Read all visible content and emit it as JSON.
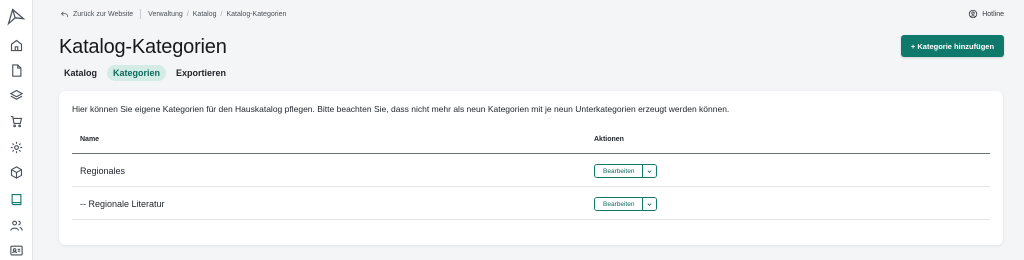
{
  "topbar": {
    "back_label": "Zurück zur Website",
    "breadcrumbs": [
      "Verwaltung",
      "Katalog",
      "Katalog-Kategorien"
    ],
    "hotline_label": "Hotline"
  },
  "page": {
    "title": "Katalog-Kategorien",
    "add_button_label": "+ Kategorie hinzufügen"
  },
  "tabs": [
    {
      "label": "Katalog",
      "active": false
    },
    {
      "label": "Kategorien",
      "active": true
    },
    {
      "label": "Exportieren",
      "active": false
    }
  ],
  "card": {
    "intro": "Hier können Sie eigene Kategorien für den Hauskatalog pflegen. Bitte beachten Sie, dass nicht mehr als neun Kategorien mit je neun Unterkategorien erzeugt werden können.",
    "columns": {
      "name": "Name",
      "actions": "Aktionen"
    },
    "rows": [
      {
        "name": "Regionales",
        "action": "Bearbeiten"
      },
      {
        "name": "-- Regionale Literatur",
        "action": "Bearbeiten"
      }
    ]
  },
  "sidebar": {
    "icons": [
      "logo-icon",
      "home-icon",
      "document-icon",
      "layers-icon",
      "cart-icon",
      "settings-icon",
      "box-icon",
      "book-icon",
      "users-icon",
      "id-card-icon"
    ],
    "active": "book-icon"
  },
  "colors": {
    "accent": "#0f7a6c",
    "accent_soft": "#d3ece6",
    "background": "#f4f5f7"
  }
}
